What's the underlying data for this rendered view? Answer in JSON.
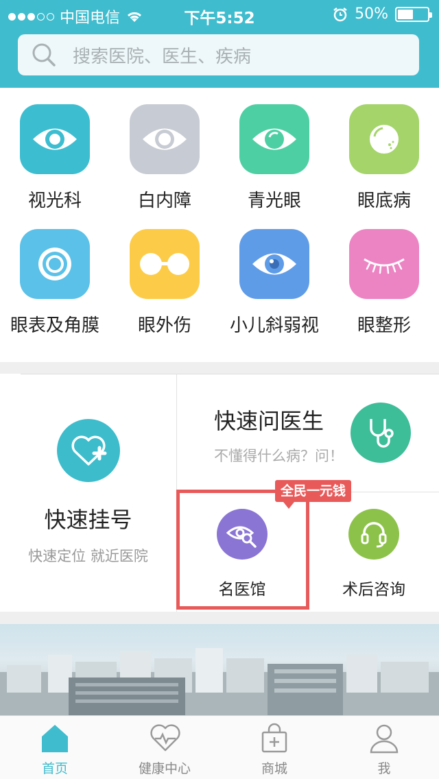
{
  "status_bar": {
    "carrier": "中国电信",
    "time": "下午5:52",
    "battery": "50%",
    "signal_filled": 3,
    "signal_total": 5,
    "battery_level": 0.5
  },
  "search": {
    "placeholder": "搜索医院、医生、疾病",
    "icon": "search-icon"
  },
  "categories": [
    {
      "label": "视光科",
      "color": "#3dbdd0",
      "icon": "eye-icon"
    },
    {
      "label": "白内障",
      "color": "#c7cbd3",
      "icon": "cataract-eye-icon"
    },
    {
      "label": "青光眼",
      "color": "#4ecfa3",
      "icon": "glaucoma-eye-icon"
    },
    {
      "label": "眼底病",
      "color": "#a4d46a",
      "icon": "fundus-icon"
    },
    {
      "label": "眼表及角膜",
      "color": "#5bc1e8",
      "icon": "cornea-icon"
    },
    {
      "label": "眼外伤",
      "color": "#fccc48",
      "icon": "glasses-icon"
    },
    {
      "label": "小儿斜弱视",
      "color": "#5f9ce8",
      "icon": "child-eye-icon"
    },
    {
      "label": "眼整形",
      "color": "#ec84c4",
      "icon": "eyelash-icon"
    }
  ],
  "services": {
    "quick_register": {
      "title": "快速挂号",
      "subtitle": "快速定位 就近医院",
      "icon": "heart-plus-icon"
    },
    "ask_doctor": {
      "title": "快速问医生",
      "subtitle": "不懂得什么病？问！",
      "icon": "stethoscope-icon"
    },
    "famous_clinic": {
      "label": "名医馆",
      "icon": "eye-search-icon",
      "badge": "全民一元钱"
    },
    "post_consult": {
      "label": "术后咨询",
      "icon": "headset-icon"
    }
  },
  "tabs": [
    {
      "label": "首页",
      "icon": "home-icon",
      "active": true
    },
    {
      "label": "健康中心",
      "icon": "heart-pulse-icon",
      "active": false
    },
    {
      "label": "商城",
      "icon": "shopping-bag-icon",
      "active": false
    },
    {
      "label": "我",
      "icon": "user-icon",
      "active": false
    }
  ],
  "colors": {
    "primary": "#3fbcce",
    "highlight": "#e85a5a"
  }
}
